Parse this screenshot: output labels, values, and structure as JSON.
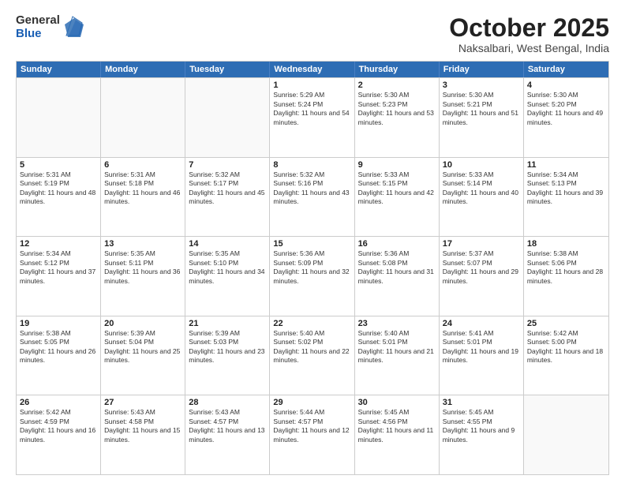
{
  "logo": {
    "general": "General",
    "blue": "Blue"
  },
  "title": "October 2025",
  "subtitle": "Naksalbari, West Bengal, India",
  "header_days": [
    "Sunday",
    "Monday",
    "Tuesday",
    "Wednesday",
    "Thursday",
    "Friday",
    "Saturday"
  ],
  "weeks": [
    [
      {
        "day": "",
        "sunrise": "",
        "sunset": "",
        "daylight": ""
      },
      {
        "day": "",
        "sunrise": "",
        "sunset": "",
        "daylight": ""
      },
      {
        "day": "",
        "sunrise": "",
        "sunset": "",
        "daylight": ""
      },
      {
        "day": "1",
        "sunrise": "Sunrise: 5:29 AM",
        "sunset": "Sunset: 5:24 PM",
        "daylight": "Daylight: 11 hours and 54 minutes."
      },
      {
        "day": "2",
        "sunrise": "Sunrise: 5:30 AM",
        "sunset": "Sunset: 5:23 PM",
        "daylight": "Daylight: 11 hours and 53 minutes."
      },
      {
        "day": "3",
        "sunrise": "Sunrise: 5:30 AM",
        "sunset": "Sunset: 5:21 PM",
        "daylight": "Daylight: 11 hours and 51 minutes."
      },
      {
        "day": "4",
        "sunrise": "Sunrise: 5:30 AM",
        "sunset": "Sunset: 5:20 PM",
        "daylight": "Daylight: 11 hours and 49 minutes."
      }
    ],
    [
      {
        "day": "5",
        "sunrise": "Sunrise: 5:31 AM",
        "sunset": "Sunset: 5:19 PM",
        "daylight": "Daylight: 11 hours and 48 minutes."
      },
      {
        "day": "6",
        "sunrise": "Sunrise: 5:31 AM",
        "sunset": "Sunset: 5:18 PM",
        "daylight": "Daylight: 11 hours and 46 minutes."
      },
      {
        "day": "7",
        "sunrise": "Sunrise: 5:32 AM",
        "sunset": "Sunset: 5:17 PM",
        "daylight": "Daylight: 11 hours and 45 minutes."
      },
      {
        "day": "8",
        "sunrise": "Sunrise: 5:32 AM",
        "sunset": "Sunset: 5:16 PM",
        "daylight": "Daylight: 11 hours and 43 minutes."
      },
      {
        "day": "9",
        "sunrise": "Sunrise: 5:33 AM",
        "sunset": "Sunset: 5:15 PM",
        "daylight": "Daylight: 11 hours and 42 minutes."
      },
      {
        "day": "10",
        "sunrise": "Sunrise: 5:33 AM",
        "sunset": "Sunset: 5:14 PM",
        "daylight": "Daylight: 11 hours and 40 minutes."
      },
      {
        "day": "11",
        "sunrise": "Sunrise: 5:34 AM",
        "sunset": "Sunset: 5:13 PM",
        "daylight": "Daylight: 11 hours and 39 minutes."
      }
    ],
    [
      {
        "day": "12",
        "sunrise": "Sunrise: 5:34 AM",
        "sunset": "Sunset: 5:12 PM",
        "daylight": "Daylight: 11 hours and 37 minutes."
      },
      {
        "day": "13",
        "sunrise": "Sunrise: 5:35 AM",
        "sunset": "Sunset: 5:11 PM",
        "daylight": "Daylight: 11 hours and 36 minutes."
      },
      {
        "day": "14",
        "sunrise": "Sunrise: 5:35 AM",
        "sunset": "Sunset: 5:10 PM",
        "daylight": "Daylight: 11 hours and 34 minutes."
      },
      {
        "day": "15",
        "sunrise": "Sunrise: 5:36 AM",
        "sunset": "Sunset: 5:09 PM",
        "daylight": "Daylight: 11 hours and 32 minutes."
      },
      {
        "day": "16",
        "sunrise": "Sunrise: 5:36 AM",
        "sunset": "Sunset: 5:08 PM",
        "daylight": "Daylight: 11 hours and 31 minutes."
      },
      {
        "day": "17",
        "sunrise": "Sunrise: 5:37 AM",
        "sunset": "Sunset: 5:07 PM",
        "daylight": "Daylight: 11 hours and 29 minutes."
      },
      {
        "day": "18",
        "sunrise": "Sunrise: 5:38 AM",
        "sunset": "Sunset: 5:06 PM",
        "daylight": "Daylight: 11 hours and 28 minutes."
      }
    ],
    [
      {
        "day": "19",
        "sunrise": "Sunrise: 5:38 AM",
        "sunset": "Sunset: 5:05 PM",
        "daylight": "Daylight: 11 hours and 26 minutes."
      },
      {
        "day": "20",
        "sunrise": "Sunrise: 5:39 AM",
        "sunset": "Sunset: 5:04 PM",
        "daylight": "Daylight: 11 hours and 25 minutes."
      },
      {
        "day": "21",
        "sunrise": "Sunrise: 5:39 AM",
        "sunset": "Sunset: 5:03 PM",
        "daylight": "Daylight: 11 hours and 23 minutes."
      },
      {
        "day": "22",
        "sunrise": "Sunrise: 5:40 AM",
        "sunset": "Sunset: 5:02 PM",
        "daylight": "Daylight: 11 hours and 22 minutes."
      },
      {
        "day": "23",
        "sunrise": "Sunrise: 5:40 AM",
        "sunset": "Sunset: 5:01 PM",
        "daylight": "Daylight: 11 hours and 21 minutes."
      },
      {
        "day": "24",
        "sunrise": "Sunrise: 5:41 AM",
        "sunset": "Sunset: 5:01 PM",
        "daylight": "Daylight: 11 hours and 19 minutes."
      },
      {
        "day": "25",
        "sunrise": "Sunrise: 5:42 AM",
        "sunset": "Sunset: 5:00 PM",
        "daylight": "Daylight: 11 hours and 18 minutes."
      }
    ],
    [
      {
        "day": "26",
        "sunrise": "Sunrise: 5:42 AM",
        "sunset": "Sunset: 4:59 PM",
        "daylight": "Daylight: 11 hours and 16 minutes."
      },
      {
        "day": "27",
        "sunrise": "Sunrise: 5:43 AM",
        "sunset": "Sunset: 4:58 PM",
        "daylight": "Daylight: 11 hours and 15 minutes."
      },
      {
        "day": "28",
        "sunrise": "Sunrise: 5:43 AM",
        "sunset": "Sunset: 4:57 PM",
        "daylight": "Daylight: 11 hours and 13 minutes."
      },
      {
        "day": "29",
        "sunrise": "Sunrise: 5:44 AM",
        "sunset": "Sunset: 4:57 PM",
        "daylight": "Daylight: 11 hours and 12 minutes."
      },
      {
        "day": "30",
        "sunrise": "Sunrise: 5:45 AM",
        "sunset": "Sunset: 4:56 PM",
        "daylight": "Daylight: 11 hours and 11 minutes."
      },
      {
        "day": "31",
        "sunrise": "Sunrise: 5:45 AM",
        "sunset": "Sunset: 4:55 PM",
        "daylight": "Daylight: 11 hours and 9 minutes."
      },
      {
        "day": "",
        "sunrise": "",
        "sunset": "",
        "daylight": ""
      }
    ]
  ]
}
